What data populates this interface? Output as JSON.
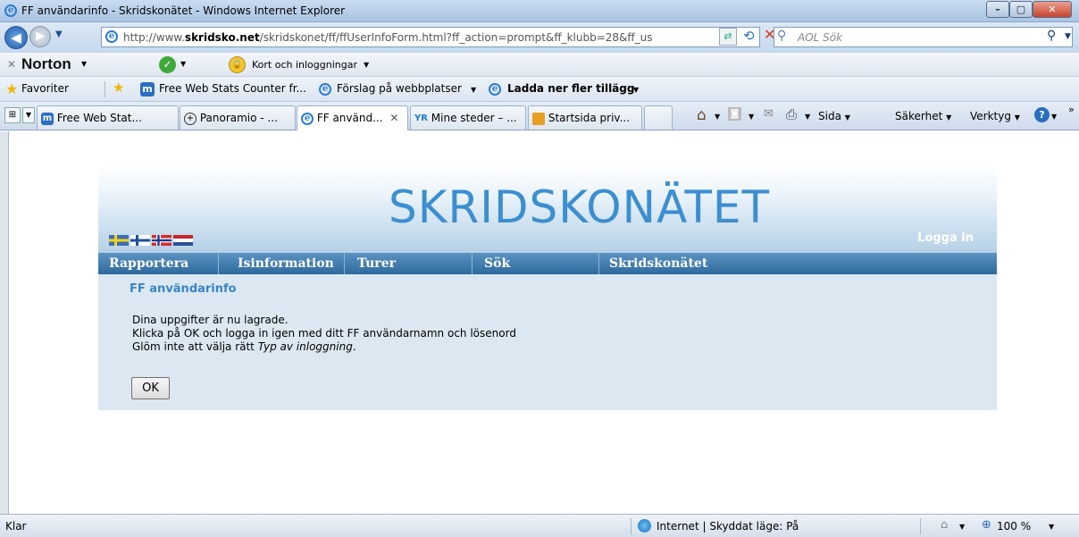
{
  "window": {
    "title": "FF användarinfo - Skridskonätet - Windows Internet Explorer",
    "min_label": "–",
    "max_label": "▢",
    "close_label": "✕"
  },
  "address_bar": {
    "url_prefix": "http://www.",
    "url_domain": "skridsko.net",
    "url_rest": "/skridskonet/ff/ffUserInfoForm.html?ff_action=prompt&ff_klubb=28&ff_us",
    "search_placeholder": "AOL Sök"
  },
  "norton_bar": {
    "brand": "Norton",
    "identity_label": "Kort och inloggningar"
  },
  "favorites_bar": {
    "favorites_label": "Favoriter",
    "items": [
      {
        "label": "Free Web Stats Counter fr..."
      },
      {
        "label": "Förslag på webbplatser"
      },
      {
        "label": "Ladda ner fler tillägg"
      }
    ]
  },
  "tabs": [
    {
      "label": "Free Web Stat...",
      "icon": "m-icon"
    },
    {
      "label": "Panoramio - ...",
      "icon": "panoramio-icon"
    },
    {
      "label": "FF använd...",
      "icon": "ie-icon",
      "active": true,
      "close": "✕"
    },
    {
      "label": "Mine steder – ...",
      "icon": "yr-icon"
    },
    {
      "label": "Startsida priv...",
      "icon": "startsida-icon"
    }
  ],
  "command_bar": {
    "page": "Sida",
    "safety": "Säkerhet",
    "tools": "Verktyg"
  },
  "site": {
    "logo": "SKRIDSKONÄTET",
    "login": "Logga in",
    "menu": [
      "Rapportera",
      "Isinformation",
      "Turer",
      "Sök",
      "Skridskonätet"
    ],
    "panel_title": "FF användarinfo",
    "line1": "Dina uppgifter är nu lagrade.",
    "line2": "Klicka på OK och logga in igen med ditt FF användarnamn och lösenord",
    "line3_prefix": "Glöm inte att välja rätt ",
    "line3_italic": "Typ av inloggning",
    "line3_suffix": ".",
    "ok_button": "OK"
  },
  "status_bar": {
    "text": "Klar",
    "zone": "Internet | Skyddat läge: På",
    "zoom": "100 %"
  },
  "colors": {
    "accent": "#3b8fd0",
    "menu_bar": "#2e6a9e",
    "panel_bg": "#dbe8f2"
  }
}
